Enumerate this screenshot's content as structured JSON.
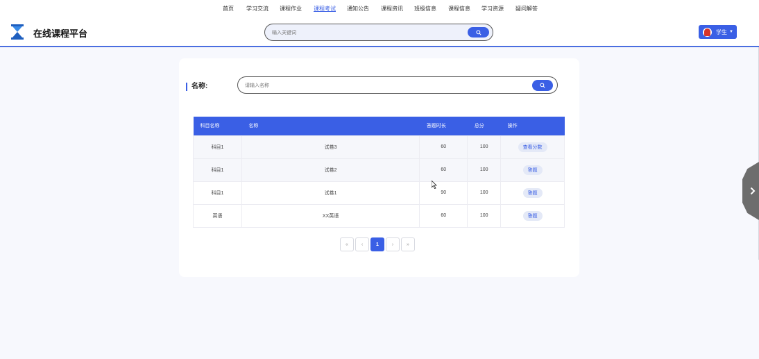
{
  "nav": {
    "items": [
      {
        "label": "首页",
        "active": false
      },
      {
        "label": "学习交流",
        "active": false
      },
      {
        "label": "课程作业",
        "active": false
      },
      {
        "label": "课程考试",
        "active": true
      },
      {
        "label": "通知公告",
        "active": false
      },
      {
        "label": "课程资讯",
        "active": false
      },
      {
        "label": "班级信息",
        "active": false
      },
      {
        "label": "课程信息",
        "active": false
      },
      {
        "label": "学习资源",
        "active": false
      },
      {
        "label": "疑问解答",
        "active": false
      }
    ]
  },
  "header": {
    "brand": "在线课程平台",
    "logo_icon": "hourglass-icon",
    "search_placeholder": "输入关键词",
    "user_label": "学生"
  },
  "filter": {
    "name_label": "名称:",
    "name_placeholder": "请输入名称"
  },
  "table": {
    "columns": [
      "科目名称",
      "名称",
      "答题时长",
      "总分",
      "操作"
    ],
    "rows": [
      {
        "subject": "科目1",
        "name": "试卷3",
        "duration": "60",
        "score": "100",
        "action": "查看分数"
      },
      {
        "subject": "科目1",
        "name": "试卷2",
        "duration": "60",
        "score": "100",
        "action": "答题"
      },
      {
        "subject": "科目1",
        "name": "试卷1",
        "duration": "90",
        "score": "100",
        "action": "答题"
      },
      {
        "subject": "英语",
        "name": "XX英语",
        "duration": "60",
        "score": "100",
        "action": "答题"
      }
    ]
  },
  "pagination": {
    "first": "«",
    "prev": "‹",
    "current": "1",
    "next": "›",
    "last": "»"
  },
  "colors": {
    "accent": "#3a5fe5",
    "background": "#f7f8fd"
  }
}
